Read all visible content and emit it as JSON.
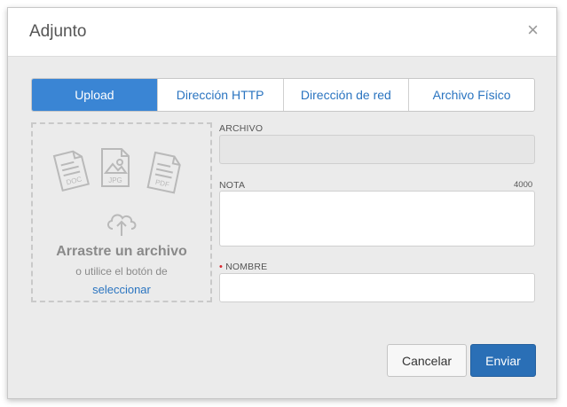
{
  "dialog": {
    "title": "Adjunto",
    "close_glyph": "×"
  },
  "tabs": [
    {
      "label": "Upload",
      "active": true
    },
    {
      "label": "Dirección HTTP",
      "active": false
    },
    {
      "label": "Dirección de red",
      "active": false
    },
    {
      "label": "Archivo Físico",
      "active": false
    }
  ],
  "dropzone": {
    "title": "Arrastre un archivo",
    "subtitle": "o utilice el botón de",
    "link": "seleccionar",
    "file_types": [
      "DOC",
      "JPG",
      "PDF"
    ]
  },
  "form": {
    "archivo": {
      "label": "ARCHIVO",
      "value": ""
    },
    "nota": {
      "label": "NOTA",
      "counter": "4000",
      "value": ""
    },
    "nombre": {
      "label": "NOMBRE",
      "required_marker": "•",
      "value": ""
    }
  },
  "buttons": {
    "cancel": "Cancelar",
    "send": "Enviar"
  },
  "colors": {
    "accent": "#3a85d4",
    "primary_button": "#2a6fb6",
    "link": "#2a74c0",
    "required": "#d9262e"
  }
}
